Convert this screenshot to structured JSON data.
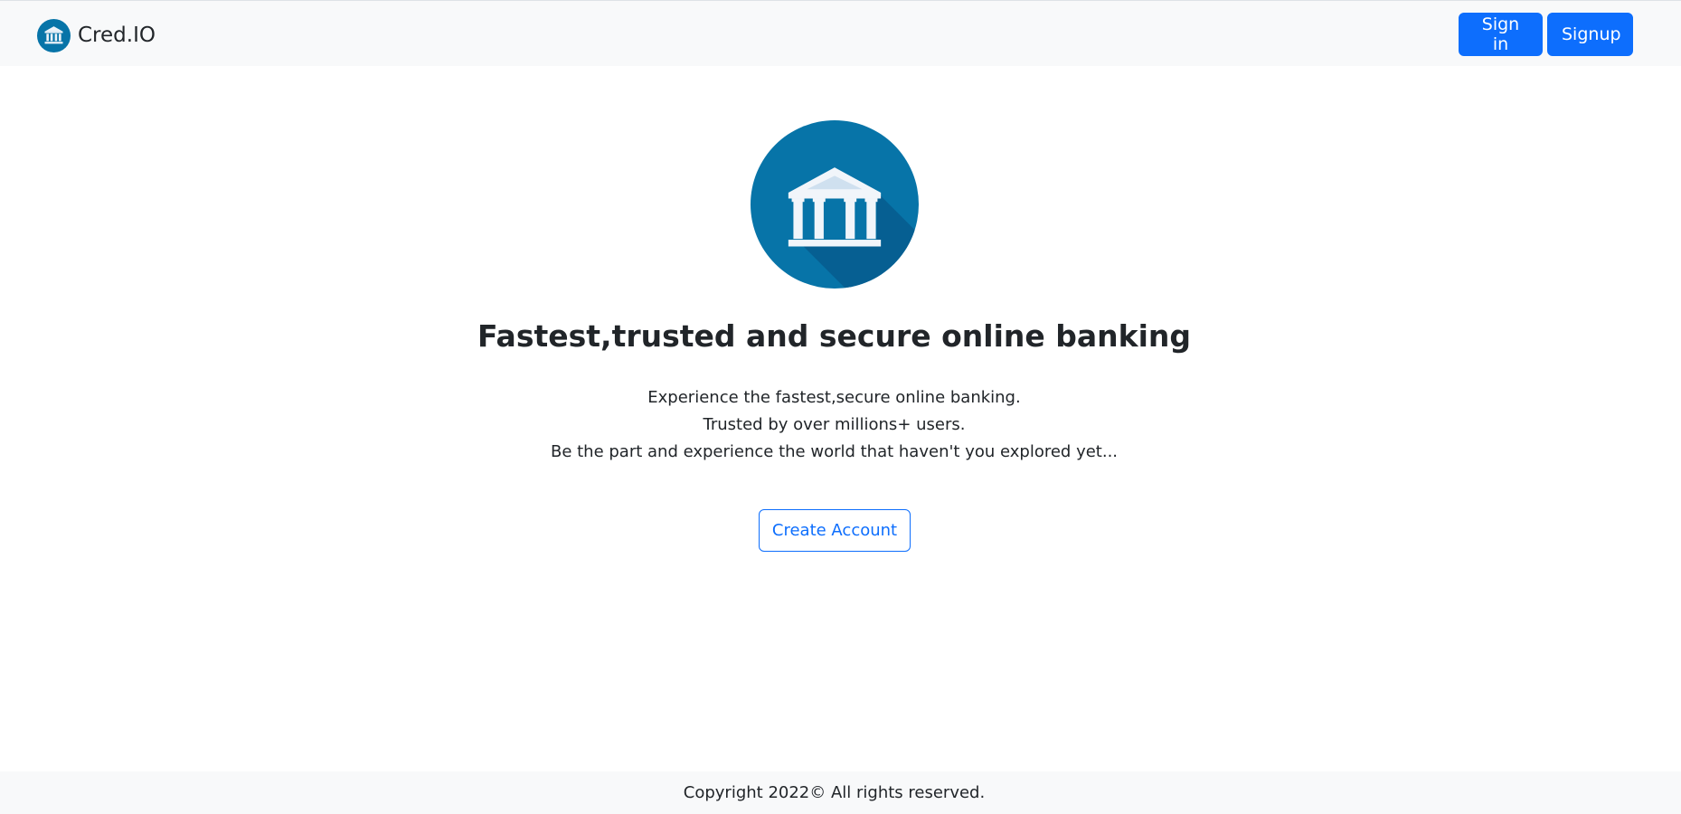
{
  "header": {
    "brand_name": "Cred.IO",
    "brand_logo_icon": "bank-icon",
    "signin_label": "Sign in",
    "signup_label": "Signup"
  },
  "hero": {
    "logo_icon": "bank-building-icon",
    "title": "Fastest,trusted and secure online banking",
    "lines": [
      "Experience the fastest,secure online banking.",
      "Trusted by over millions+ users.",
      "Be the part and experience the world that haven't you explored yet..."
    ],
    "cta_label": "Create Account"
  },
  "footer": {
    "copyright": "Copyright 2022© All rights reserved."
  },
  "colors": {
    "primary": "#0d6efd",
    "navbar_bg": "#f8f9fa",
    "logo_circle": "#0774a8",
    "logo_shadow": "#065f92",
    "building": "#eef3f9"
  }
}
